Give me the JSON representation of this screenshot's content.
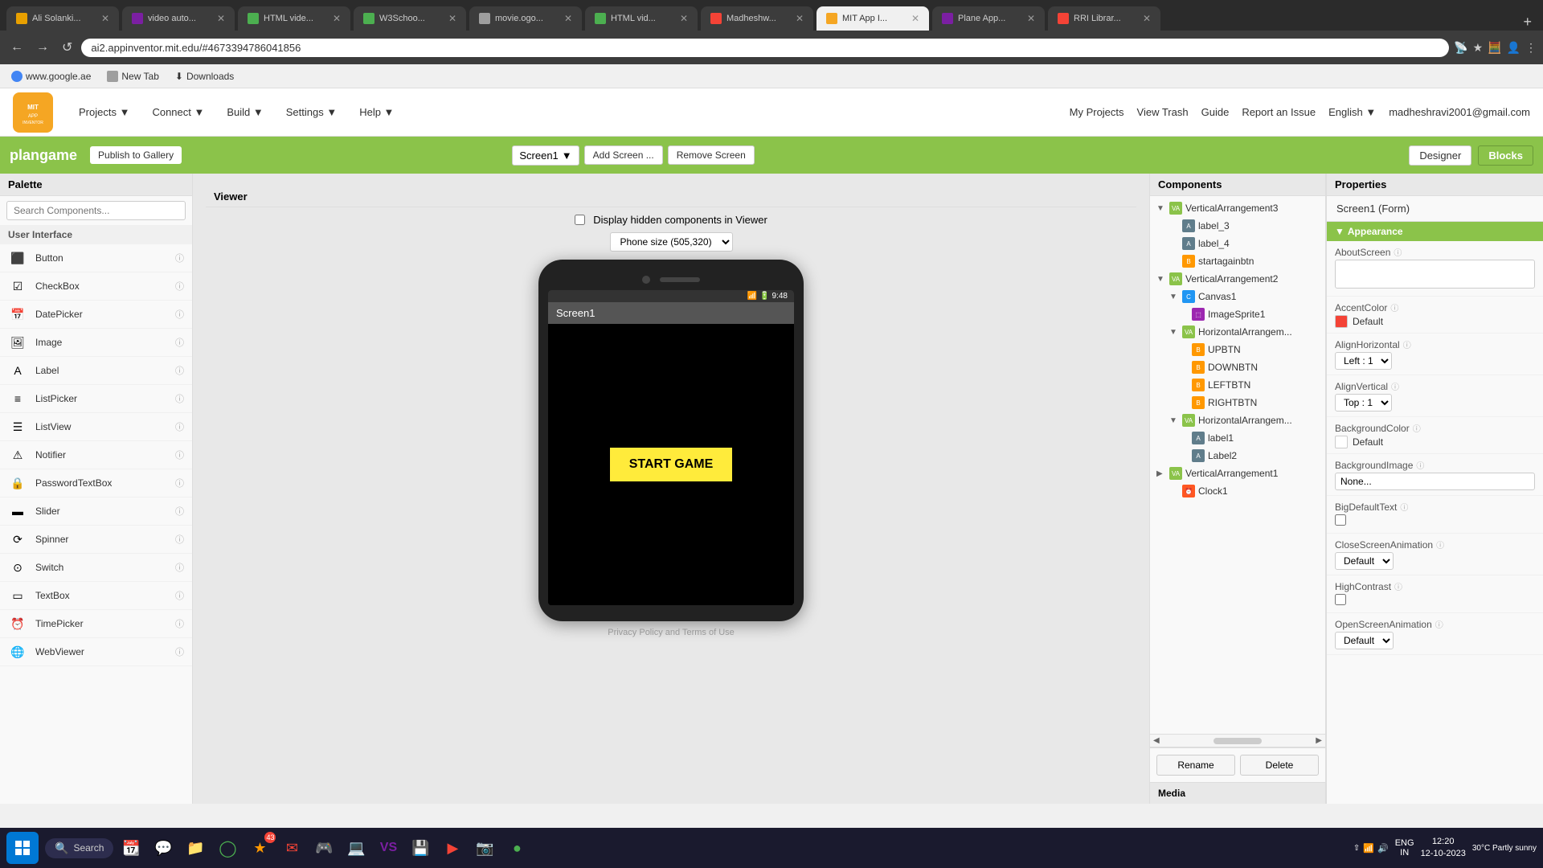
{
  "browser": {
    "address": "ai2.appinventor.mit.edu/#4673394786041856",
    "tabs": [
      {
        "id": "t1",
        "label": "Ali Solanki...",
        "favicon_color": "#e8a000",
        "active": false
      },
      {
        "id": "t2",
        "label": "video auto...",
        "favicon_color": "#7b1fa2",
        "active": false
      },
      {
        "id": "t3",
        "label": "HTML vide...",
        "favicon_color": "#4caf50",
        "active": false
      },
      {
        "id": "t4",
        "label": "W3Schoo...",
        "favicon_color": "#4caf50",
        "active": false
      },
      {
        "id": "t5",
        "label": "movie.ogo...",
        "favicon_color": "#9e9e9e",
        "active": false
      },
      {
        "id": "t6",
        "label": "HTML vid...",
        "favicon_color": "#4caf50",
        "active": false
      },
      {
        "id": "t7",
        "label": "Madheshw...",
        "favicon_color": "#f44336",
        "active": false
      },
      {
        "id": "t8",
        "label": "MIT App I...",
        "favicon_color": "#f5a623",
        "active": true
      },
      {
        "id": "t9",
        "label": "Plane App...",
        "favicon_color": "#7b1fa2",
        "active": false
      },
      {
        "id": "t10",
        "label": "RRI Librar...",
        "favicon_color": "#f44336",
        "active": false
      }
    ]
  },
  "bookmarks": [
    {
      "label": "www.google.ae",
      "favicon_color": "#4285f4"
    },
    {
      "label": "New Tab",
      "favicon_color": "#9e9e9e"
    },
    {
      "label": "Downloads",
      "favicon_color": "#9e9e9e"
    }
  ],
  "mit_header": {
    "logo_text": "MIT\nAPP INVENTOR",
    "nav_items": [
      "Projects",
      "Connect",
      "Build",
      "Settings",
      "Help"
    ],
    "right_links": [
      "My Projects",
      "View Trash",
      "Guide",
      "Report an Issue",
      "English",
      "madheshravi2001@gmail.com"
    ]
  },
  "project_bar": {
    "project_name": "plangame",
    "publish_label": "Publish to Gallery",
    "screen_name": "Screen1",
    "add_screen_label": "Add Screen ...",
    "remove_screen_label": "Remove Screen",
    "designer_label": "Designer",
    "blocks_label": "Blocks"
  },
  "palette": {
    "title": "Palette",
    "search_placeholder": "Search Components...",
    "section": "User Interface",
    "components": [
      {
        "name": "Button",
        "has_info": true
      },
      {
        "name": "CheckBox",
        "has_info": true
      },
      {
        "name": "DatePicker",
        "has_info": true
      },
      {
        "name": "Image",
        "has_info": true
      },
      {
        "name": "Label",
        "has_info": true
      },
      {
        "name": "ListPicker",
        "has_info": true
      },
      {
        "name": "ListView",
        "has_info": true
      },
      {
        "name": "Notifier",
        "has_info": true
      },
      {
        "name": "PasswordTextBox",
        "has_info": true
      },
      {
        "name": "Slider",
        "has_info": true
      },
      {
        "name": "Spinner",
        "has_info": true
      },
      {
        "name": "Switch",
        "has_info": true
      },
      {
        "name": "TextBox",
        "has_info": true
      },
      {
        "name": "TimePicker",
        "has_info": true
      },
      {
        "name": "WebViewer",
        "has_info": true
      }
    ]
  },
  "viewer": {
    "title": "Viewer",
    "hidden_components_label": "Display hidden components in Viewer",
    "phone_size_label": "Phone size (505,320)",
    "phone_time": "9:48",
    "app_title": "Screen1",
    "start_game_label": "START GAME",
    "privacy_label": "Privacy Policy and Terms of Use"
  },
  "components_panel": {
    "title": "Components",
    "tree": [
      {
        "id": "va3",
        "label": "VerticalArrangement3",
        "level": 0,
        "type": "arrangement",
        "expanded": true
      },
      {
        "id": "l3",
        "label": "label_3",
        "level": 1,
        "type": "label"
      },
      {
        "id": "l4",
        "label": "label_4",
        "level": 1,
        "type": "label"
      },
      {
        "id": "startbtn",
        "label": "startagainbtn",
        "level": 1,
        "type": "button"
      },
      {
        "id": "va2",
        "label": "VerticalArrangement2",
        "level": 0,
        "type": "arrangement",
        "expanded": true
      },
      {
        "id": "canvas1",
        "label": "Canvas1",
        "level": 1,
        "type": "canvas",
        "expanded": true
      },
      {
        "id": "imgsprite1",
        "label": "ImageSprite1",
        "level": 2,
        "type": "image"
      },
      {
        "id": "ha1",
        "label": "HorizontalArrangem...",
        "level": 1,
        "type": "arrangement",
        "expanded": true
      },
      {
        "id": "upbtn",
        "label": "UPBTN",
        "level": 2,
        "type": "button"
      },
      {
        "id": "downbtn",
        "label": "DOWNBTN",
        "level": 2,
        "type": "button"
      },
      {
        "id": "leftbtn",
        "label": "LEFTBTN",
        "level": 2,
        "type": "button"
      },
      {
        "id": "rightbtn",
        "label": "RIGHTBTN",
        "level": 2,
        "type": "button"
      },
      {
        "id": "ha2",
        "label": "HorizontalArrangem...",
        "level": 1,
        "type": "arrangement",
        "expanded": true
      },
      {
        "id": "lbl1",
        "label": "label1",
        "level": 2,
        "type": "label"
      },
      {
        "id": "lbl2",
        "label": "Label2",
        "level": 2,
        "type": "label"
      },
      {
        "id": "va1",
        "label": "VerticalArrangement1",
        "level": 0,
        "type": "arrangement",
        "expanded": false
      },
      {
        "id": "clock1",
        "label": "Clock1",
        "level": 1,
        "type": "clock"
      }
    ],
    "rename_label": "Rename",
    "delete_label": "Delete",
    "media_label": "Media"
  },
  "properties_panel": {
    "title": "Properties",
    "screen_label": "Screen1 (Form)",
    "section_label": "Appearance",
    "props": [
      {
        "name": "AboutScreen",
        "type": "textarea",
        "value": ""
      },
      {
        "name": "AccentColor",
        "type": "color",
        "color": "#f44336",
        "label": "Default"
      },
      {
        "name": "AlignHorizontal",
        "type": "dropdown",
        "value": "Left : 1"
      },
      {
        "name": "AlignVertical",
        "type": "dropdown",
        "value": "Top : 1"
      },
      {
        "name": "BackgroundColor",
        "type": "color",
        "color": "#ffffff",
        "label": "Default"
      },
      {
        "name": "BackgroundImage",
        "type": "input",
        "value": "None..."
      },
      {
        "name": "BigDefaultText",
        "type": "checkbox",
        "value": false
      },
      {
        "name": "CloseScreenAnimation",
        "type": "dropdown",
        "value": "Default"
      },
      {
        "name": "HighContrast",
        "type": "checkbox",
        "value": false
      },
      {
        "name": "OpenScreenAnimation",
        "type": "dropdown",
        "value": "Default"
      }
    ]
  },
  "taskbar": {
    "start_icon": "⊞",
    "search_label": "Search",
    "time": "12:20",
    "date": "12-10-2023",
    "lang": "ENG\nIN",
    "weather": "30°C\nPartly sunny"
  }
}
